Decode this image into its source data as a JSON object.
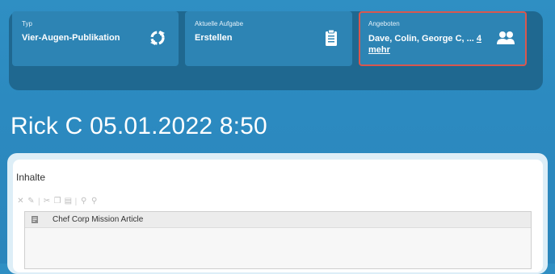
{
  "header": {
    "cards": [
      {
        "label": "Typ",
        "value": "Vier-Augen-Publikation",
        "icon": "refresh-icon"
      },
      {
        "label": "Aktuelle Aufgabe",
        "value": "Erstellen",
        "icon": "clipboard-icon"
      },
      {
        "label": "Angeboten",
        "value": "Dave, Colin, George C, ...",
        "more_link": "4 mehr",
        "icon": "users-icon"
      }
    ]
  },
  "page_title": "Rick C 05.01.2022 8:50",
  "content": {
    "section_label": "Inhalte",
    "toolbar_icons": [
      "remove-icon",
      "edit-icon",
      "cut-icon",
      "copy-icon",
      "paste-icon",
      "assign-icon",
      "unassign-icon"
    ],
    "items": [
      {
        "label": "Chef Corp Mission Article",
        "icon": "document-icon"
      }
    ]
  },
  "colors": {
    "background": "#2c8ac0",
    "header_panel": "#1f6890",
    "card": "#2d84b4",
    "highlight_border": "#d9574f"
  }
}
